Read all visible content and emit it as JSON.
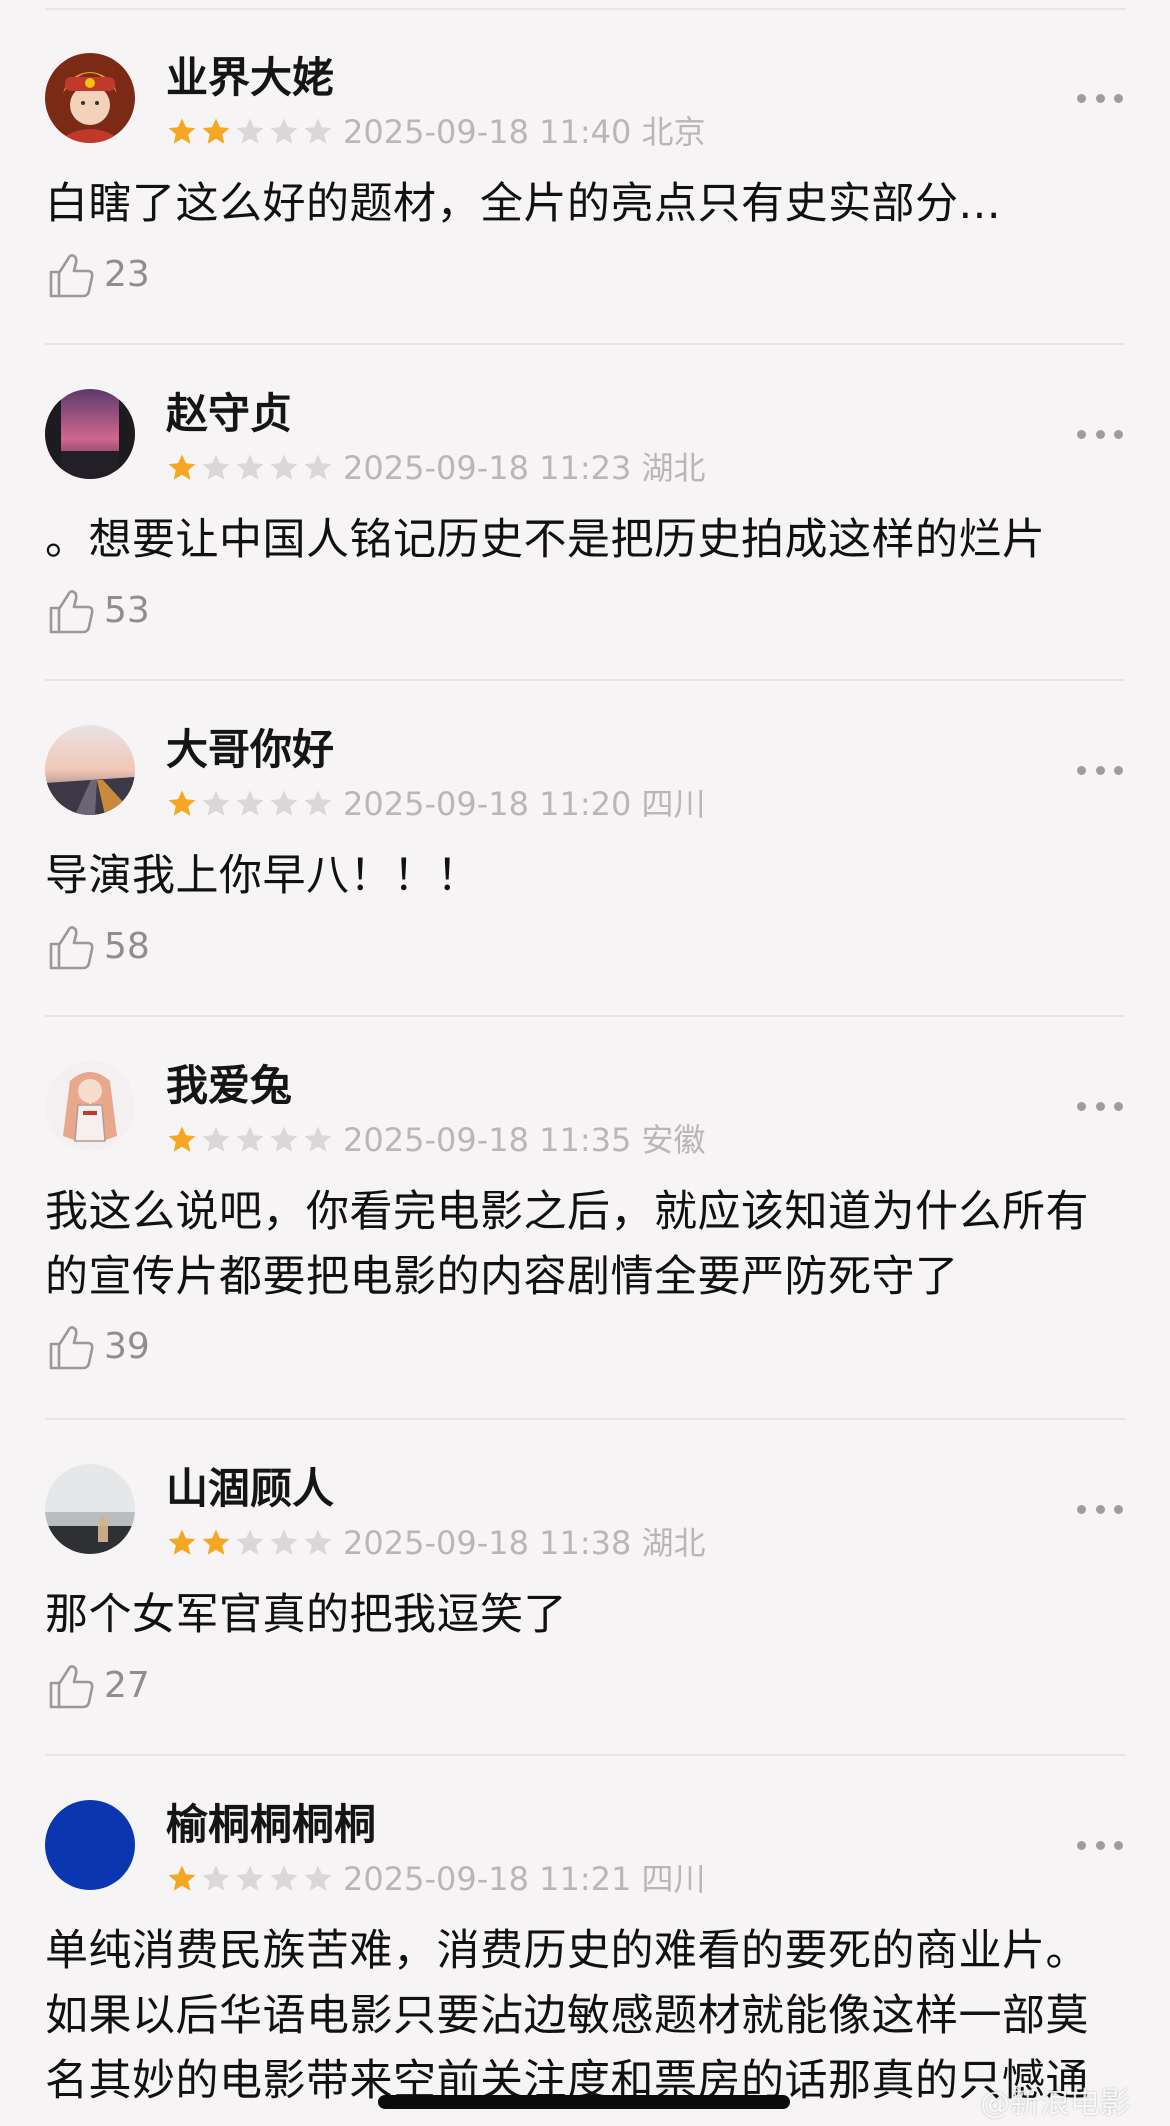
{
  "colors": {
    "star_filled": "#f5a623",
    "star_empty": "#d9d7d9",
    "meta_text": "#b8b6b8",
    "divider": "#e7e4e6",
    "background": "#f6f4f5"
  },
  "reviews": [
    {
      "username": "业界大姥",
      "rating": 2,
      "datetime": "2025-09-18 11:40",
      "location": "北京",
      "text": "白瞎了这么好的题材，全片的亮点只有史实部分...",
      "likes": "23",
      "avatar": "opera-costume-avatar"
    },
    {
      "username": "赵守贞",
      "rating": 1,
      "datetime": "2025-09-18 11:23",
      "location": "湖北",
      "text": "。想要让中国人铭记历史不是把历史拍成这样的烂片",
      "likes": "53",
      "avatar": "pink-sunset-window-avatar"
    },
    {
      "username": "大哥你好",
      "rating": 1,
      "datetime": "2025-09-18 11:20",
      "location": "四川",
      "text": "导演我上你早八！！！",
      "likes": "58",
      "avatar": "road-sunset-avatar"
    },
    {
      "username": "我爱兔",
      "rating": 1,
      "datetime": "2025-09-18 11:35",
      "location": "安徽",
      "text": "我这么说吧，你看完电影之后，就应该知道为什么所有的宣传片都要把电影的内容剧情全要严防死守了",
      "likes": "39",
      "avatar": "anime-girl-avatar"
    },
    {
      "username": "山涸顾人",
      "rating": 2,
      "datetime": "2025-09-18 11:38",
      "location": "湖北",
      "text": "那个女军官真的把我逗笑了",
      "likes": "27",
      "avatar": "beach-figure-avatar"
    },
    {
      "username": "榆桐桐桐桐",
      "rating": 1,
      "datetime": "2025-09-18 11:21",
      "location": "四川",
      "text": "单纯消费民族苦难，消费历史的难看的要死的商业片。如果以后华语电影只要沾边敏感题材就能像这样一部莫名其妙的电影带来空前关注度和票房的话那真的只憾通",
      "likes": "",
      "avatar": "blue-circle-avatar"
    }
  ],
  "watermark": "@新浪电影"
}
